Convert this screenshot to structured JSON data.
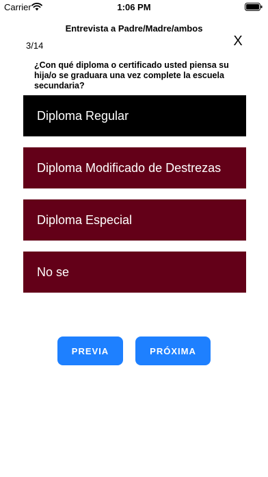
{
  "status_bar": {
    "carrier": "Carrier",
    "time": "1:06 PM",
    "icons": [
      "wifi-icon",
      "battery-icon"
    ]
  },
  "header": {
    "title": "Entrevista a Padre/Madre/ambos",
    "progress": "3/14",
    "close_label": "X"
  },
  "question": {
    "text": "¿Con qué diploma o certificado usted piensa su hija/o se graduara una vez complete la escuela secundaria?"
  },
  "options": [
    {
      "label": "Diploma Regular",
      "selected": true
    },
    {
      "label": "Diploma Modificado de Destrezas",
      "selected": false
    },
    {
      "label": "Diploma Especial",
      "selected": false
    },
    {
      "label": "No se",
      "selected": false
    }
  ],
  "navigation": {
    "prev_label": "PREVIA",
    "next_label": "PRÓXIMA"
  },
  "colors": {
    "option_background": "#630018",
    "option_selected_background": "#000000",
    "button_background": "#1e80ff"
  }
}
